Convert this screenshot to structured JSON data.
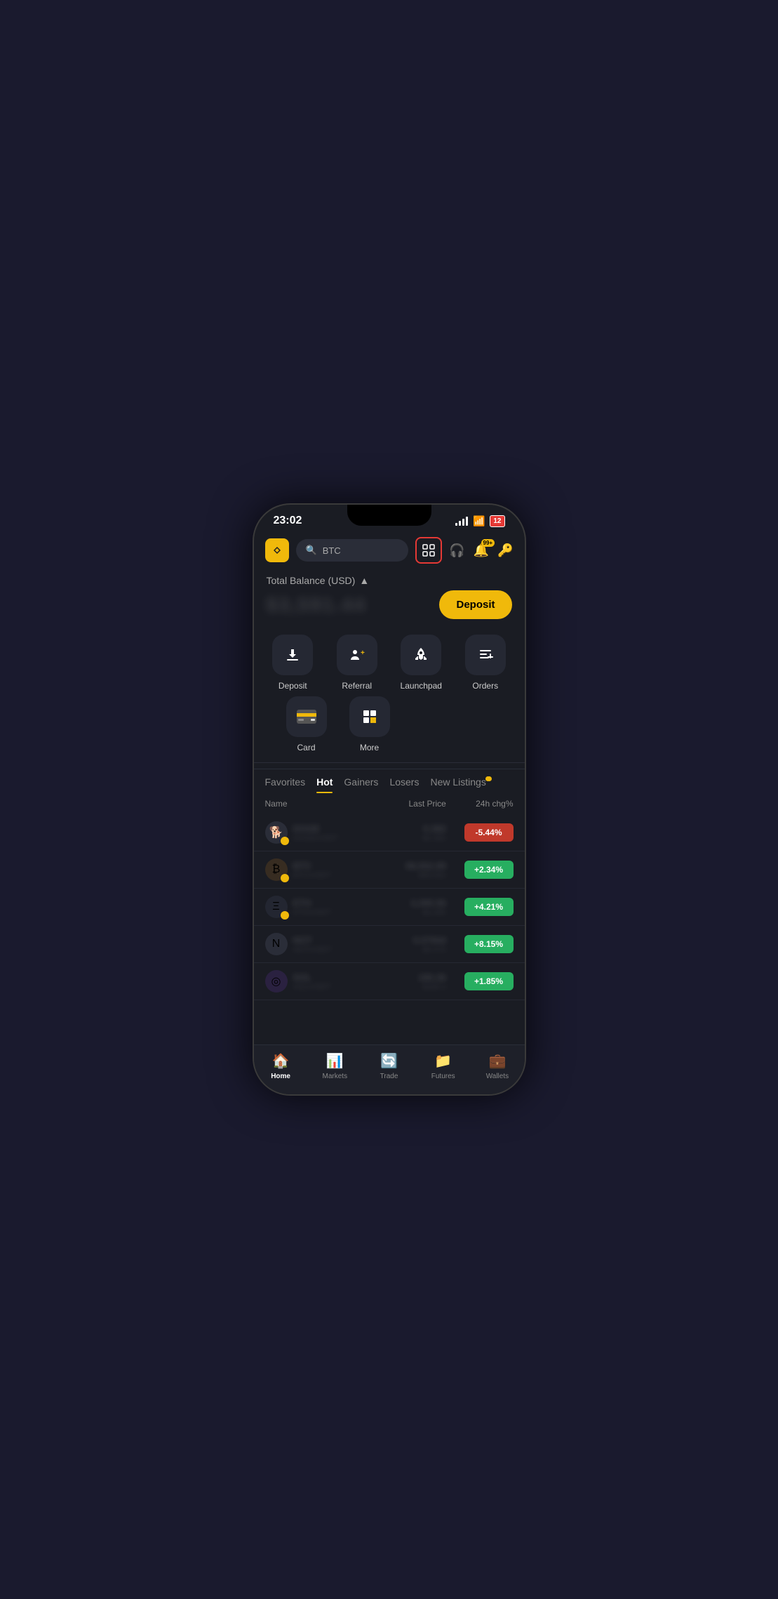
{
  "status": {
    "time": "23:02",
    "battery": "12"
  },
  "header": {
    "search_placeholder": "BTC",
    "search_icon": "🔍",
    "scan_icon": "⊞",
    "headset_icon": "🎧",
    "notifications_badge": "99+",
    "profile_icon": "👤"
  },
  "balance": {
    "label": "Total Balance (USD)",
    "amount": "$3,591.44",
    "deposit_btn": "Deposit"
  },
  "quick_actions": {
    "row1": [
      {
        "id": "deposit",
        "icon": "⬇",
        "label": "Deposit"
      },
      {
        "id": "referral",
        "icon": "👤+",
        "label": "Referral"
      },
      {
        "id": "launchpad",
        "icon": "🚀",
        "label": "Launchpad"
      },
      {
        "id": "orders",
        "icon": "☰",
        "label": "Orders"
      }
    ],
    "row2": [
      {
        "id": "card",
        "icon": "💳",
        "label": "Card"
      },
      {
        "id": "more",
        "icon": "⊞",
        "label": "More"
      }
    ]
  },
  "market_tabs": [
    {
      "id": "favorites",
      "label": "Favorites",
      "active": false
    },
    {
      "id": "hot",
      "label": "Hot",
      "active": true
    },
    {
      "id": "gainers",
      "label": "Gainers",
      "active": false
    },
    {
      "id": "losers",
      "label": "Losers",
      "active": false
    },
    {
      "id": "new_listings",
      "label": "New Listings",
      "active": false,
      "dot": true
    }
  ],
  "table": {
    "col_name": "Name",
    "col_price": "Last Price",
    "col_change": "24h chg%",
    "rows": [
      {
        "symbol": "DOGE",
        "sub": "DOGE/USDT",
        "price": "0.382",
        "sub_price": "0.382",
        "change": "-5.44%",
        "positive": false
      },
      {
        "symbol": "BTC",
        "sub": "BTC/USDT",
        "price": "98,562.89",
        "sub_price": "98,562",
        "change": "+2.34%",
        "positive": true
      },
      {
        "symbol": "ETH",
        "sub": "ETH/USDT",
        "price": "3,395.56",
        "sub_price": "3,395",
        "change": "+4.21%",
        "positive": true
      },
      {
        "symbol": "NOT",
        "sub": "NOT/USDT",
        "price": "0.07944",
        "sub_price": "0.079",
        "change": "+8.15%",
        "positive": true
      },
      {
        "symbol": "SOL",
        "sub": "SOL/USDT",
        "price": "186.36",
        "sub_price": "186.3",
        "change": "+1.85%",
        "positive": true
      }
    ]
  },
  "bottom_nav": [
    {
      "id": "home",
      "icon": "🏠",
      "label": "Home",
      "active": true
    },
    {
      "id": "markets",
      "icon": "📊",
      "label": "Markets",
      "active": false
    },
    {
      "id": "trade",
      "icon": "🔄",
      "label": "Trade",
      "active": false
    },
    {
      "id": "futures",
      "icon": "📁",
      "label": "Futures",
      "active": false
    },
    {
      "id": "wallets",
      "icon": "💼",
      "label": "Wallets",
      "active": false
    }
  ]
}
